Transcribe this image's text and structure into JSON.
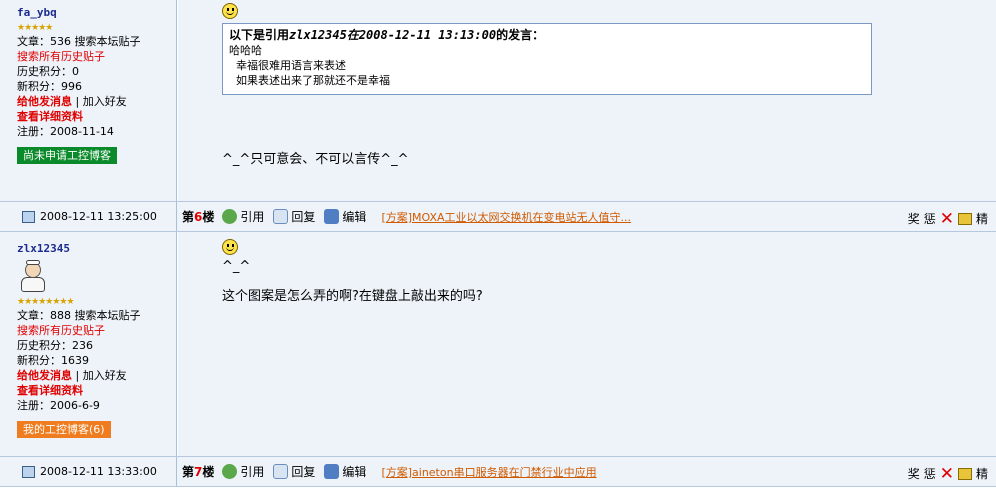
{
  "post1": {
    "username": "fa_ybq",
    "stars": "★★★★★",
    "articles_label": "文章：536",
    "search_board": "搜索本坛贴子",
    "search_history": "搜索所有历史贴子",
    "history_points": "历史积分：0",
    "new_points": "新积分：996",
    "message_link": "给他发消息",
    "sep": "|",
    "add_friend": "加入好友",
    "view_profile": "查看详细资料",
    "registered": "注册：2008-11-14",
    "blog_badge": "尚未申请工控博客",
    "quote_header_prefix": "以下是引用",
    "quote_header_user": "zlx12345在2008-12-11 13:13:00",
    "quote_header_suffix": "的发言：",
    "quote_lines": [
      "哈哈哈",
      "  幸福很难用语言来表述",
      "  如果表述出来了那就还不是幸福"
    ],
    "content": "^_^只可意会、不可以言传^_^",
    "footer": {
      "timestamp": "2008-12-11 13:25:00",
      "floor_prefix": "第",
      "floor_num": "6",
      "floor_suffix": "楼",
      "quote_label": "引用",
      "reply_label": "回复",
      "edit_label": "编辑",
      "ad_link": "[方案]MOXA工业以太网交换机在变电站无人值守...",
      "reward": "奖",
      "punish": "惩",
      "essence": "精"
    }
  },
  "post2": {
    "username": "zlx12345",
    "stars": "★★★★★★★★",
    "articles_label": "文章：888",
    "search_board": "搜索本坛贴子",
    "search_history": "搜索所有历史贴子",
    "history_points": "历史积分：236",
    "new_points": "新积分：1639",
    "message_link": "给他发消息",
    "sep": "|",
    "add_friend": "加入好友",
    "view_profile": "查看详细资料",
    "registered": "注册：2006-6-9",
    "blog_badge": "我的工控博客(6)",
    "content_line1": "^_^",
    "content_line2": "这个图案是怎么弄的啊?在键盘上敲出来的吗?",
    "footer": {
      "timestamp": "2008-12-11 13:33:00",
      "floor_prefix": "第",
      "floor_num": "7",
      "floor_suffix": "楼",
      "quote_label": "引用",
      "reply_label": "回复",
      "edit_label": "编辑",
      "ad_link": "[方案]aineton串口服务器在门禁行业中应用",
      "reward": "奖",
      "punish": "惩",
      "essence": "精"
    }
  }
}
